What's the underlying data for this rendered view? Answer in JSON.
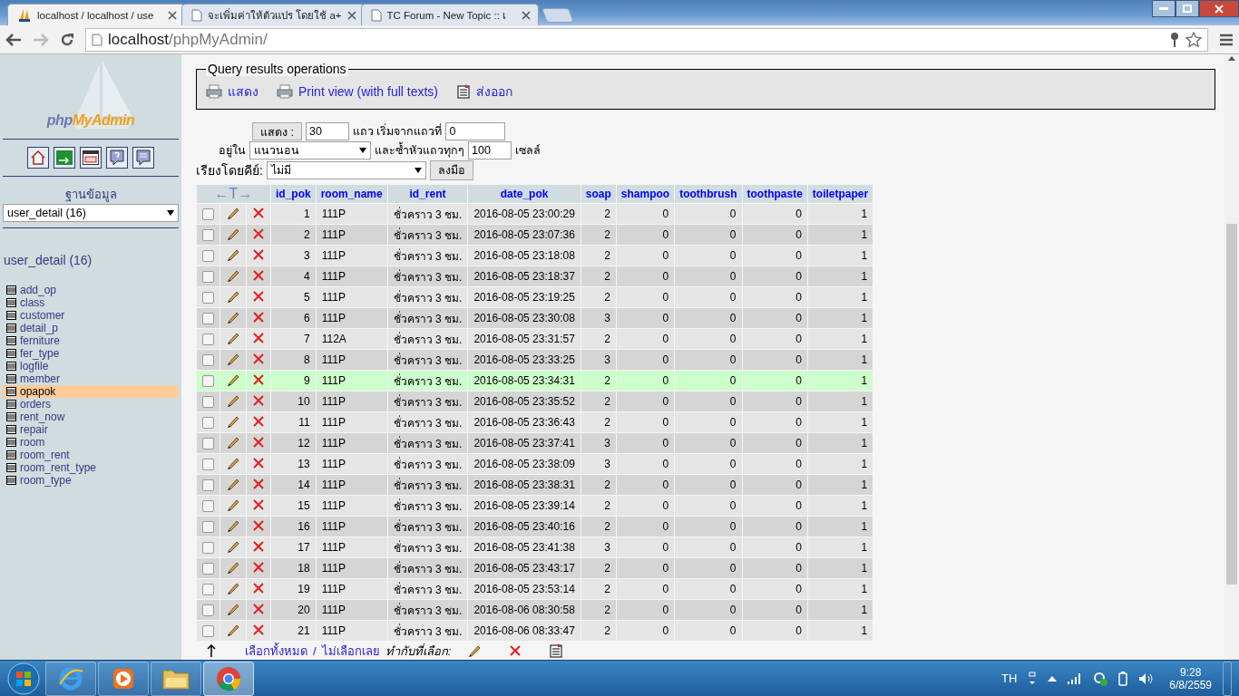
{
  "browser": {
    "tabs": [
      {
        "title": "localhost / localhost / use",
        "selected": true,
        "kind": "pma"
      },
      {
        "title": "จะเพิ่มค่าให้ตัวแปร โดยใช้ a+",
        "selected": false,
        "kind": "page"
      },
      {
        "title": "TC Forum - New Topic :: เ",
        "selected": false,
        "kind": "page"
      }
    ],
    "address": {
      "host": "localhost",
      "path": "/phpMyAdmin/"
    }
  },
  "sidebar": {
    "logo": {
      "part1": "php",
      "part2": "MyAdmin"
    },
    "db_label": "ฐานข้อมูล",
    "db_select": "user_detail (16)",
    "db_heading": "user_detail (16)",
    "tables": [
      {
        "name": "add_op",
        "selected": false
      },
      {
        "name": "class",
        "selected": false
      },
      {
        "name": "customer",
        "selected": false
      },
      {
        "name": "detail_p",
        "selected": false
      },
      {
        "name": "ferniture",
        "selected": false
      },
      {
        "name": "fer_type",
        "selected": false
      },
      {
        "name": "logfile",
        "selected": false
      },
      {
        "name": "member",
        "selected": false
      },
      {
        "name": "opapok",
        "selected": true
      },
      {
        "name": "orders",
        "selected": false
      },
      {
        "name": "rent_now",
        "selected": false
      },
      {
        "name": "repair",
        "selected": false
      },
      {
        "name": "room",
        "selected": false
      },
      {
        "name": "room_rent",
        "selected": false
      },
      {
        "name": "room_rent_type",
        "selected": false
      },
      {
        "name": "room_type",
        "selected": false
      }
    ]
  },
  "operations": {
    "legend": "Query results operations",
    "links": [
      {
        "label": "แสดง",
        "kind": "print"
      },
      {
        "label": "Print view (with full texts)",
        "kind": "print"
      },
      {
        "label": "ส่งออก",
        "kind": "export"
      }
    ]
  },
  "nav_form": {
    "show_button": "แสดง :",
    "rows_value": "30",
    "rows_label": "แถว เริ่มจากแถวที่",
    "start_value": "0",
    "mode_label": "อยู่ใน",
    "mode_value": "แนวนอน",
    "repeat_label": "และซ้ำหัวแถวทุกๆ",
    "repeat_value": "100",
    "cells_label": "เซลล์",
    "sort_label": "เรียงโดยคีย์:",
    "sort_value": "ไม่มี",
    "go_button": "ลงมือ"
  },
  "table": {
    "arrows": "←T→",
    "columns": [
      "id_pok",
      "room_name",
      "id_rent",
      "date_pok",
      "soap",
      "shampoo",
      "toothbrush",
      "toothpaste",
      "toiletpaper"
    ],
    "rows": [
      {
        "cells": [
          "1",
          "111P",
          "ชั่วคราว 3 ชม.",
          "2016-08-05 23:00:29",
          "2",
          "0",
          "0",
          "0",
          "1"
        ],
        "checked": false,
        "highlighted": false
      },
      {
        "cells": [
          "2",
          "111P",
          "ชั่วคราว 3 ชม.",
          "2016-08-05 23:07:36",
          "2",
          "0",
          "0",
          "0",
          "1"
        ],
        "checked": false,
        "highlighted": false
      },
      {
        "cells": [
          "3",
          "111P",
          "ชั่วคราว 3 ชม.",
          "2016-08-05 23:18:08",
          "2",
          "0",
          "0",
          "0",
          "1"
        ],
        "checked": false,
        "highlighted": false
      },
      {
        "cells": [
          "4",
          "111P",
          "ชั่วคราว 3 ชม.",
          "2016-08-05 23:18:37",
          "2",
          "0",
          "0",
          "0",
          "1"
        ],
        "checked": false,
        "highlighted": false
      },
      {
        "cells": [
          "5",
          "111P",
          "ชั่วคราว 3 ชม.",
          "2016-08-05 23:19:25",
          "2",
          "0",
          "0",
          "0",
          "1"
        ],
        "checked": false,
        "highlighted": false
      },
      {
        "cells": [
          "6",
          "111P",
          "ชั่วคราว 3 ชม.",
          "2016-08-05 23:30:08",
          "3",
          "0",
          "0",
          "0",
          "1"
        ],
        "checked": false,
        "highlighted": false
      },
      {
        "cells": [
          "7",
          "112A",
          "ชั่วคราว 3 ชม.",
          "2016-08-05 23:31:57",
          "2",
          "0",
          "0",
          "0",
          "1"
        ],
        "checked": false,
        "highlighted": false
      },
      {
        "cells": [
          "8",
          "111P",
          "ชั่วคราว 3 ชม.",
          "2016-08-05 23:33:25",
          "3",
          "0",
          "0",
          "0",
          "1"
        ],
        "checked": false,
        "highlighted": false
      },
      {
        "cells": [
          "9",
          "111P",
          "ชั่วคราว 3 ชม.",
          "2016-08-05 23:34:31",
          "2",
          "0",
          "0",
          "0",
          "1"
        ],
        "checked": false,
        "highlighted": true
      },
      {
        "cells": [
          "10",
          "111P",
          "ชั่วคราว 3 ชม.",
          "2016-08-05 23:35:52",
          "2",
          "0",
          "0",
          "0",
          "1"
        ],
        "checked": false,
        "highlighted": false
      },
      {
        "cells": [
          "11",
          "111P",
          "ชั่วคราว 3 ชม.",
          "2016-08-05 23:36:43",
          "2",
          "0",
          "0",
          "0",
          "1"
        ],
        "checked": false,
        "highlighted": false
      },
      {
        "cells": [
          "12",
          "111P",
          "ชั่วคราว 3 ชม.",
          "2016-08-05 23:37:41",
          "3",
          "0",
          "0",
          "0",
          "1"
        ],
        "checked": false,
        "highlighted": false
      },
      {
        "cells": [
          "13",
          "111P",
          "ชั่วคราว 3 ชม.",
          "2016-08-05 23:38:09",
          "3",
          "0",
          "0",
          "0",
          "1"
        ],
        "checked": false,
        "highlighted": false
      },
      {
        "cells": [
          "14",
          "111P",
          "ชั่วคราว 3 ชม.",
          "2016-08-05 23:38:31",
          "2",
          "0",
          "0",
          "0",
          "1"
        ],
        "checked": false,
        "highlighted": false
      },
      {
        "cells": [
          "15",
          "111P",
          "ชั่วคราว 3 ชม.",
          "2016-08-05 23:39:14",
          "2",
          "0",
          "0",
          "0",
          "1"
        ],
        "checked": false,
        "highlighted": false
      },
      {
        "cells": [
          "16",
          "111P",
          "ชั่วคราว 3 ชม.",
          "2016-08-05 23:40:16",
          "2",
          "0",
          "0",
          "0",
          "1"
        ],
        "checked": false,
        "highlighted": false
      },
      {
        "cells": [
          "17",
          "111P",
          "ชั่วคราว 3 ชม.",
          "2016-08-05 23:41:38",
          "3",
          "0",
          "0",
          "0",
          "1"
        ],
        "checked": false,
        "highlighted": false
      },
      {
        "cells": [
          "18",
          "111P",
          "ชั่วคราว 3 ชม.",
          "2016-08-05 23:43:17",
          "2",
          "0",
          "0",
          "0",
          "1"
        ],
        "checked": false,
        "highlighted": false
      },
      {
        "cells": [
          "19",
          "111P",
          "ชั่วคราว 3 ชม.",
          "2016-08-05 23:53:14",
          "2",
          "0",
          "0",
          "0",
          "1"
        ],
        "checked": false,
        "highlighted": false
      },
      {
        "cells": [
          "20",
          "111P",
          "ชั่วคราว 3 ชม.",
          "2016-08-06 08:30:58",
          "2",
          "0",
          "0",
          "0",
          "1"
        ],
        "checked": false,
        "highlighted": false
      },
      {
        "cells": [
          "21",
          "111P",
          "ชั่วคราว 3 ชม.",
          "2016-08-06 08:33:47",
          "2",
          "0",
          "0",
          "0",
          "1"
        ],
        "checked": false,
        "highlighted": false
      }
    ]
  },
  "footer": {
    "select_all": "เลือกทั้งหมด",
    "separator": "/",
    "select_none": "ไม่เลือกเลย",
    "with_selected": "ทำกับที่เลือก:"
  },
  "taskbar": {
    "apps": [
      {
        "kind": "ie",
        "selected": false
      },
      {
        "kind": "media",
        "selected": false
      },
      {
        "kind": "folder",
        "selected": false
      },
      {
        "kind": "chrome",
        "selected": true
      }
    ],
    "language": "TH",
    "time": "9:28",
    "date": "6/8/2559"
  }
}
